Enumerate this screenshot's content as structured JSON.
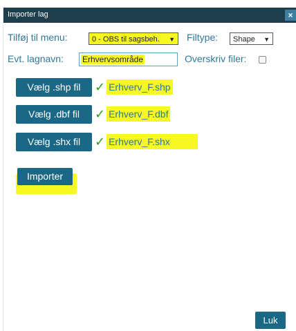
{
  "dialog": {
    "title": "Importer lag",
    "close_glyph": "×"
  },
  "menu": {
    "label": "Tilføj til menu:",
    "selected": "0 - OBS til sagsbeh."
  },
  "filetype": {
    "label": "Filtype:",
    "selected": "Shape"
  },
  "layername": {
    "label": "Evt. lagnavn:",
    "value": "Erhvervsområde"
  },
  "overwrite": {
    "label": "Overskriv filer:",
    "checked": false
  },
  "files": [
    {
      "button": "Vælg .shp fil",
      "filename": "Erhverv_F.shp",
      "status_icon": "checkmark-icon"
    },
    {
      "button": "Vælg .dbf fil",
      "filename": "Erhverv_F.dbf",
      "status_icon": "checkmark-icon"
    },
    {
      "button": "Vælg .shx fil",
      "filename": "Erhverv_F.shx",
      "status_icon": "checkmark-icon"
    }
  ],
  "import_button": "Importer",
  "close_button": "Luk",
  "colors": {
    "titlebar": "#1e3d4d",
    "button": "#1b6886",
    "label": "#2e7898",
    "highlight": "#f7f722",
    "check": "#2a9d1e"
  }
}
